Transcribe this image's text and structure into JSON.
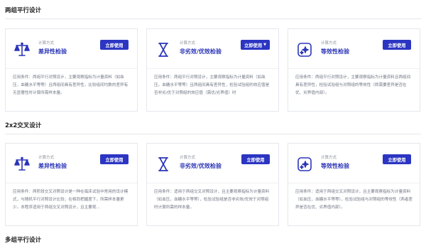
{
  "sections": [
    {
      "title": "两组平行设计",
      "cards": [
        {
          "icon": "scale-icon",
          "small_label": "计算方式",
          "method": "差异性检验",
          "button": "立即使用",
          "dropdown": false,
          "desc": "应用条件：两组平行对照设计，主要观察指标为计量资料（如血压，血糖水平等等）且两组间具有差异性，比较组间均数的差异有无显著性时计算所需样本量。"
        },
        {
          "icon": "hourglass-icon",
          "small_label": "计算方式",
          "method": "非劣效/优效检验",
          "button": "立即使用",
          "dropdown": true,
          "desc": "应用条件：两组平行对照设计，主要观察指标为计量资料（如血压，血糖水平等等）且两组间具有差异性，检验试验组的效应值是否非劣/优于对照组的效应值（需优/劣界值）时"
        },
        {
          "icon": "sparkle-icon",
          "small_label": "计算方式",
          "method": "等效性检验",
          "button": "立即使用",
          "dropdown": false,
          "desc": "应用条件：两组平行对照设计，主要观察指标为计量资料且两组间具有差异性，检验试验组与对照组的等效性（即需要差异是否在优、劣界值内部）。"
        }
      ]
    },
    {
      "title": "2x2交叉设计",
      "cards": [
        {
          "icon": "scale-icon",
          "small_label": "计算方式",
          "method": "差异性检验",
          "button": "立即使用",
          "dropdown": false,
          "desc": "应用条件：两阶段交叉对照设计是一种在临床试验中常用的设计模式，与随机平行对照设计比较，在相同把握度下，所需样本量更少。本程序适用于两组交叉对照设计，且主要观…"
        },
        {
          "icon": "hourglass-icon",
          "small_label": "计算方式",
          "method": "非劣效/优效检验",
          "button": "立即使用",
          "dropdown": true,
          "desc": "应用条件：适用于两组交叉对照设计，且主要观察指标为计量资料（如血压，血糖水平等等），检验试验组是否非劣效/优效于对照组时计算所需的样本量。"
        },
        {
          "icon": "sparkle-icon",
          "small_label": "计算方式",
          "method": "等效性检验",
          "button": "立即使用",
          "dropdown": false,
          "desc": "应用条件：适用于两组交叉对照设计，且主要观察指标为计量资料（如血压，血糖水平等等），检验试验组与对照组的等效性（两者差异是否在优、劣界值内部）。"
        }
      ]
    },
    {
      "title": "多组平行设计",
      "cards": []
    }
  ]
}
